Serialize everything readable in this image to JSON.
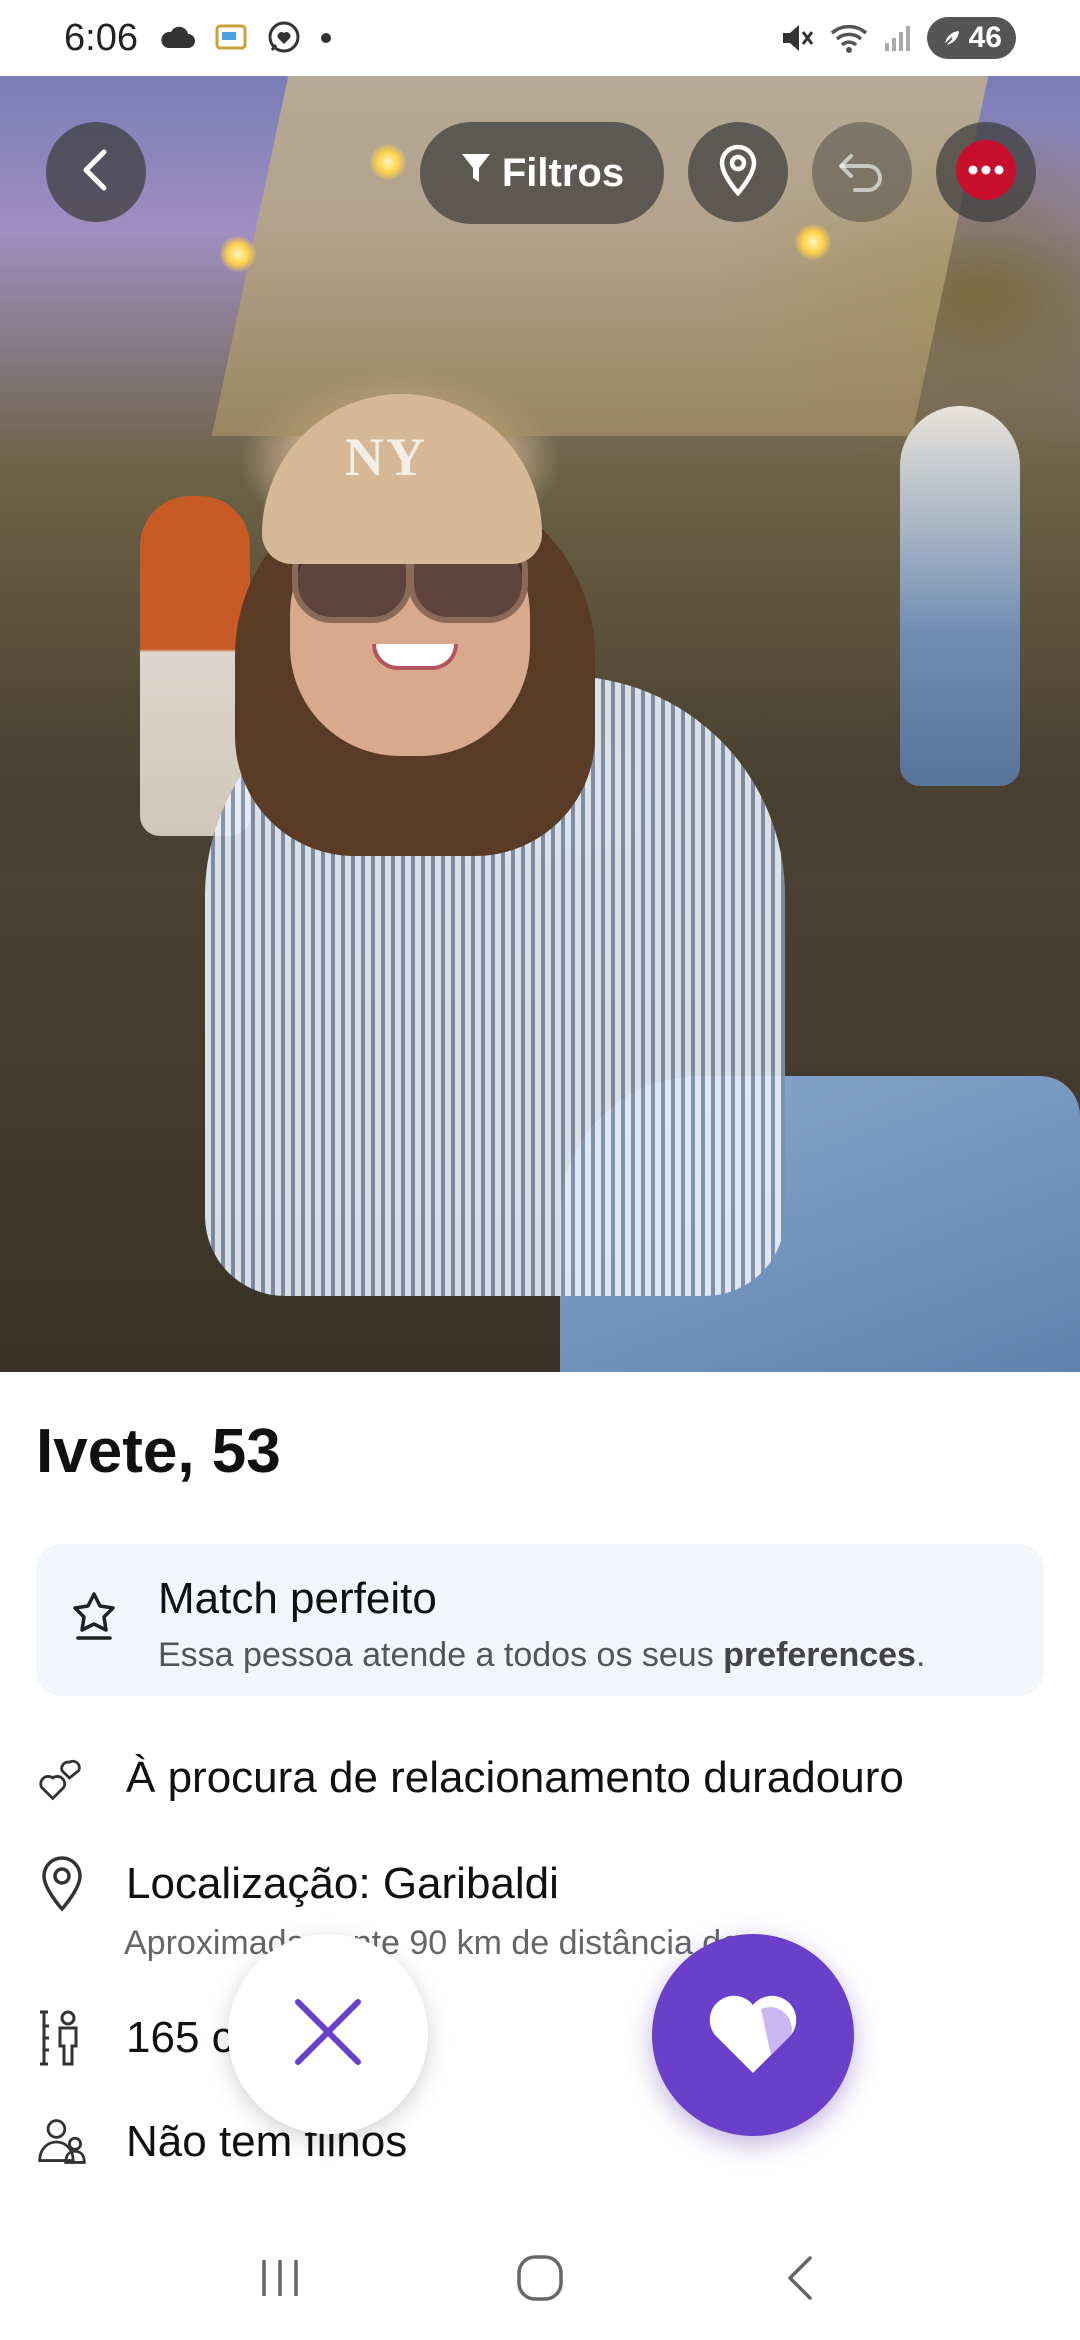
{
  "status_bar": {
    "time": "6:06",
    "battery": "46",
    "icons_left": [
      "cloud-icon",
      "cast-icon",
      "chat-icon",
      "dot-icon"
    ],
    "icons_right": [
      "mute-icon",
      "wifi-icon",
      "signal-icon",
      "battery-icon"
    ]
  },
  "photo": {
    "cap_text": "NY"
  },
  "top_controls": {
    "filters_label": "Filtros",
    "icons": [
      "back-icon",
      "filter-icon",
      "location-pin-icon",
      "undo-icon",
      "more-icon"
    ]
  },
  "profile": {
    "name_age": "Ivete, 53",
    "match_card": {
      "title": "Match perfeito",
      "subtitle_prefix": "Essa pessoa atende a todos os seus ",
      "subtitle_bold": "preferences",
      "subtitle_suffix": "."
    },
    "details": [
      {
        "icon": "heart-outline-icon",
        "text": "À procura de relacionamento duradouro"
      },
      {
        "icon": "location-pin-icon",
        "text": "Localização: Garibaldi",
        "sub": "Aproximadamente 90 km de distância de"
      },
      {
        "icon": "height-icon",
        "text": "165 cm"
      },
      {
        "icon": "children-icon",
        "text": "Não tem filhos"
      }
    ]
  },
  "actions": {
    "dislike_icon": "close-icon",
    "like_icon": "heart-icon"
  },
  "colors": {
    "accent": "#6a3fc9",
    "match_card_bg": "#f2f5f9",
    "more_button_dot": "#c8102e"
  },
  "navbar": {
    "icons": [
      "recents-icon",
      "home-icon",
      "back-nav-icon"
    ]
  }
}
